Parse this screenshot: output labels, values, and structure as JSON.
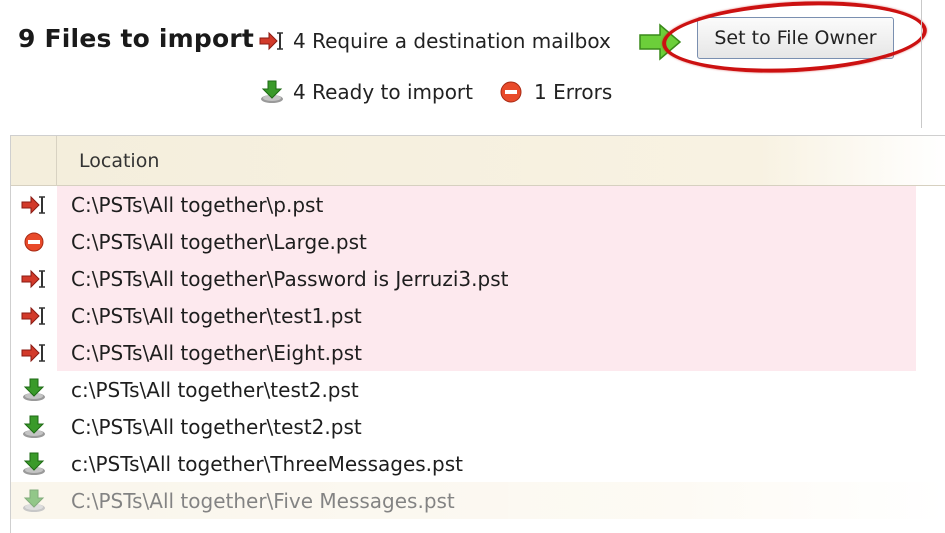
{
  "header": {
    "title": "9 Files to import",
    "status_require": "4 Require a destination mailbox",
    "status_ready": "4 Ready to import",
    "status_errors": "1 Errors",
    "set_owner_button": "Set to File Owner"
  },
  "table": {
    "column_location": "Location",
    "rows": [
      {
        "path": "C:\\PSTs\\All together\\p.pst",
        "status": "require",
        "icon": "import-mailbox-icon"
      },
      {
        "path": "C:\\PSTs\\All together\\Large.pst",
        "status": "error",
        "icon": "error-icon"
      },
      {
        "path": "C:\\PSTs\\All together\\Password is Jerruzi3.pst",
        "status": "require",
        "icon": "import-mailbox-icon"
      },
      {
        "path": "C:\\PSTs\\All together\\test1.pst",
        "status": "require",
        "icon": "import-mailbox-icon"
      },
      {
        "path": "C:\\PSTs\\All together\\Eight.pst",
        "status": "require",
        "icon": "import-mailbox-icon"
      },
      {
        "path": "c:\\PSTs\\All together\\test2.pst",
        "status": "ready",
        "icon": "ready-download-icon"
      },
      {
        "path": "C:\\PSTs\\All together\\test2.pst",
        "status": "ready",
        "icon": "ready-download-icon"
      },
      {
        "path": "c:\\PSTs\\All together\\ThreeMessages.pst",
        "status": "ready",
        "icon": "ready-download-icon"
      },
      {
        "path": "C:\\PSTs\\All together\\Five Messages.pst",
        "status": "ready",
        "icon": "ready-download-icon"
      }
    ]
  },
  "colors": {
    "error_row_bg": "#fde9ee",
    "header_bg": "#f4eedc",
    "highlight_ring": "#cc1111",
    "ready_green": "#3a9a2a",
    "import_red": "#d23a2a"
  }
}
